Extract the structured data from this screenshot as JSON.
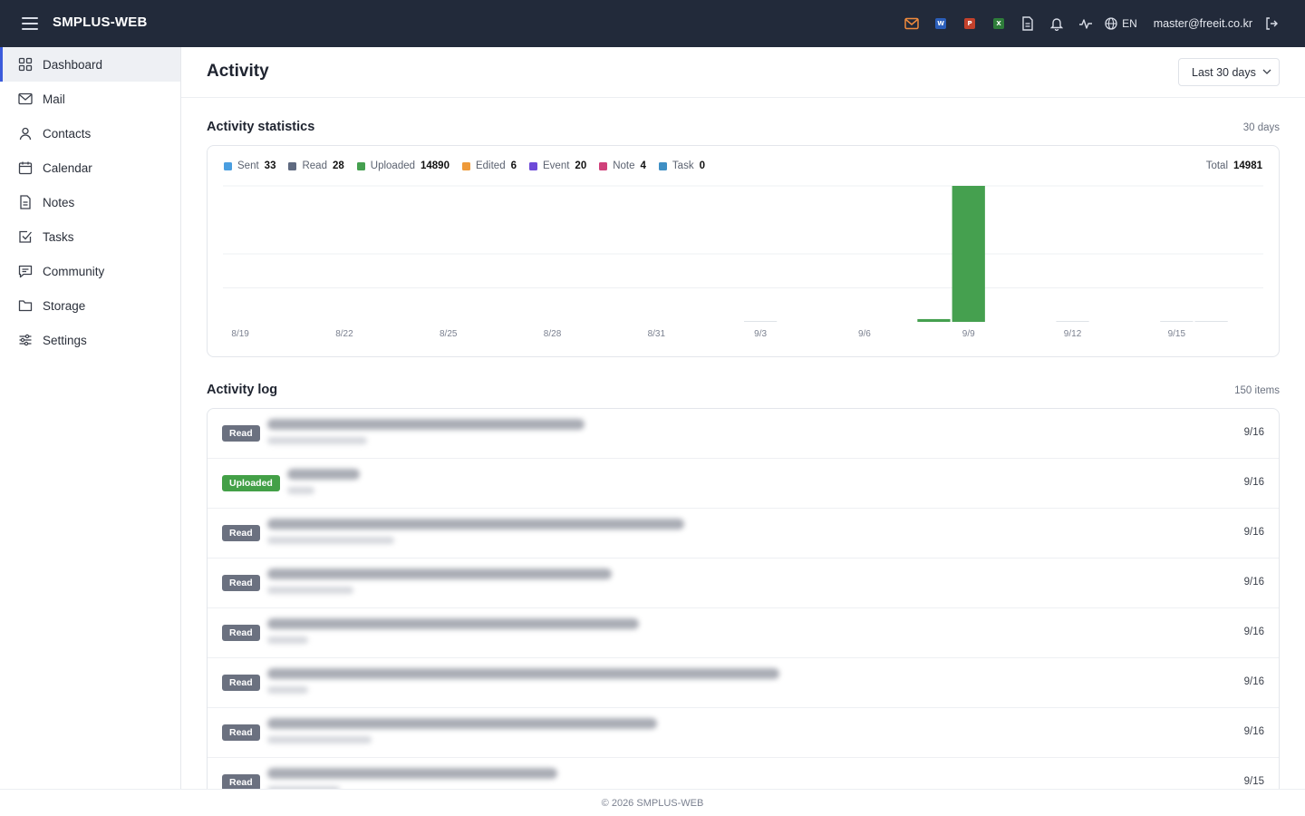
{
  "app": {
    "brand": "SMPLUS-WEB",
    "lang": "EN",
    "user_email": "master@freeit.co.kr"
  },
  "topbar_icons": [
    {
      "name": "mail-icon",
      "color": "#f08a3c"
    },
    {
      "name": "word-icon",
      "letter": "W",
      "color": "#2b5eb9"
    },
    {
      "name": "powerpoint-icon",
      "letter": "P",
      "color": "#c4412b"
    },
    {
      "name": "excel-icon",
      "letter": "X",
      "color": "#2e7d3a"
    },
    {
      "name": "document-icon"
    },
    {
      "name": "bell-icon"
    },
    {
      "name": "activity-icon"
    },
    {
      "name": "globe-icon"
    },
    {
      "name": "logout-icon"
    }
  ],
  "sidebar": {
    "items": [
      {
        "label": "Dashboard",
        "icon": "grid-icon",
        "active": true
      },
      {
        "label": "Mail",
        "icon": "mail-icon"
      },
      {
        "label": "Contacts",
        "icon": "user-icon"
      },
      {
        "label": "Calendar",
        "icon": "calendar-icon"
      },
      {
        "label": "Notes",
        "icon": "note-icon"
      },
      {
        "label": "Tasks",
        "icon": "checkbox-icon"
      },
      {
        "label": "Community",
        "icon": "chat-icon"
      },
      {
        "label": "Storage",
        "icon": "folder-icon"
      },
      {
        "label": "Settings",
        "icon": "sliders-icon"
      }
    ]
  },
  "page": {
    "title": "Activity",
    "range_select": "Last 30 days"
  },
  "stats": {
    "title": "Activity statistics",
    "meta": "30 days",
    "total_label": "Total",
    "total_value": "14981",
    "legend": [
      {
        "label": "Sent",
        "value": "33",
        "color": "#4a9ee0"
      },
      {
        "label": "Read",
        "value": "28",
        "color": "#5f6a80"
      },
      {
        "label": "Uploaded",
        "value": "14890",
        "color": "#45a04f"
      },
      {
        "label": "Edited",
        "value": "6",
        "color": "#ee9a3a"
      },
      {
        "label": "Event",
        "value": "20",
        "color": "#6d4ad8"
      },
      {
        "label": "Note",
        "value": "4",
        "color": "#d0407a"
      },
      {
        "label": "Task",
        "value": "0",
        "color": "#3f8fc4"
      }
    ]
  },
  "chart_data": {
    "type": "bar",
    "x": [
      "8/19",
      "8/20",
      "8/21",
      "8/22",
      "8/23",
      "8/24",
      "8/25",
      "8/26",
      "8/27",
      "8/28",
      "8/29",
      "8/30",
      "8/31",
      "9/1",
      "9/2",
      "9/3",
      "9/4",
      "9/5",
      "9/6",
      "9/7",
      "9/8",
      "9/9",
      "9/10",
      "9/11",
      "9/12",
      "9/13",
      "9/14",
      "9/15",
      "9/16",
      "9/17"
    ],
    "tick_labels": [
      "8/19",
      "8/22",
      "8/25",
      "8/28",
      "8/31",
      "9/3",
      "9/6",
      "9/9",
      "9/12",
      "9/15"
    ],
    "values": [
      0,
      0,
      0,
      0,
      0,
      0,
      0,
      0,
      0,
      0,
      0,
      0,
      0,
      0,
      0,
      3,
      0,
      0,
      0,
      0,
      300,
      14660,
      0,
      0,
      3,
      0,
      0,
      3,
      15,
      0
    ],
    "ylim": [
      0,
      14660
    ],
    "color": "#45a04f",
    "grid": true
  },
  "log": {
    "title": "Activity log",
    "meta": "150 items",
    "rows": [
      {
        "badge": "Read",
        "type": "read",
        "date": "9/16"
      },
      {
        "badge": "Uploaded",
        "type": "uploaded",
        "date": "9/16"
      },
      {
        "badge": "Read",
        "type": "read",
        "date": "9/16"
      },
      {
        "badge": "Read",
        "type": "read",
        "date": "9/16"
      },
      {
        "badge": "Read",
        "type": "read",
        "date": "9/16"
      },
      {
        "badge": "Read",
        "type": "read",
        "date": "9/16"
      },
      {
        "badge": "Read",
        "type": "read",
        "date": "9/16"
      },
      {
        "badge": "Read",
        "type": "read",
        "date": "9/15"
      }
    ]
  },
  "footer": {
    "text": "© 2026 SMPLUS-WEB"
  }
}
